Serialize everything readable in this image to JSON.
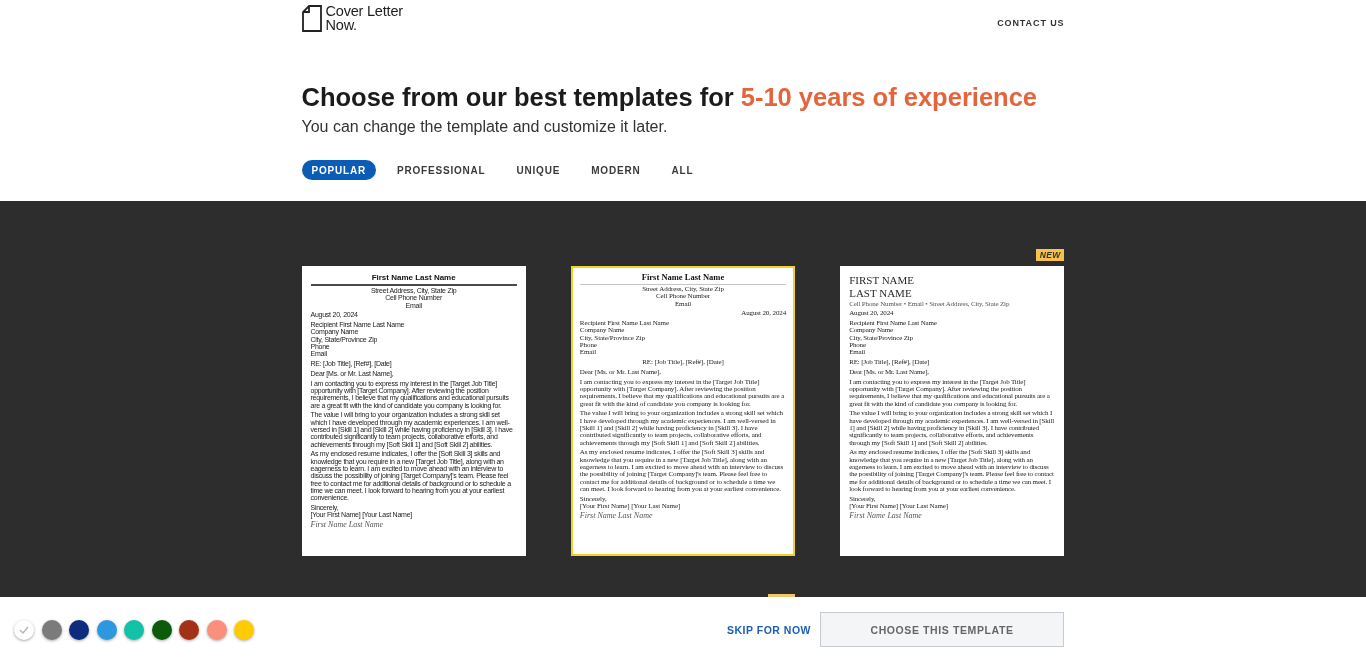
{
  "header": {
    "logo_lines": [
      "Cover Letter",
      "Now."
    ],
    "contact_link": "CONTACT US"
  },
  "heading": {
    "text": "Choose from our best templates for",
    "highlight": "5-10 years of experience",
    "subtitle": "You can change the template and customize it later."
  },
  "tabs": [
    {
      "label": "POPULAR",
      "selected": true
    },
    {
      "label": "PROFESSIONAL",
      "selected": false
    },
    {
      "label": "UNIQUE",
      "selected": false
    },
    {
      "label": "MODERN",
      "selected": false
    },
    {
      "label": "ALL",
      "selected": false
    }
  ],
  "templates": [
    {
      "kind": "classic",
      "selected": false,
      "name_lines": [
        "First Name Last Name"
      ],
      "contact_lines": [
        "Street Address, City, State Zip",
        "Cell Phone Number",
        "Email"
      ],
      "date": "August 20, 2024",
      "recipient_lines": [
        "Recipient First Name Last Name",
        "Company Name",
        "City, State/Province Zip",
        "Phone",
        "Email"
      ],
      "subject": "RE: [Job Title], [Ref#], [Date]",
      "salutation": "Dear [Ms. or Mr. Last Name],",
      "paragraphs": [
        "I am contacting you to express my interest in the [Target Job Title] opportunity with [Target Company]. After reviewing the position requirements, I believe that my qualifications and educational pursuits are a great fit with the kind of candidate you company is looking for.",
        "The value I will bring to your organization includes a strong skill set which I have developed through my academic experiences. I am well-versed in [Skill 1] and [Skill 2] while having proficiency in [Skill 3]. I have contributed significantly to team projects, collaborative efforts, and achievements through my [Soft Skill 1] and [Soft Skill 2] abilities.",
        "As my enclosed resume indicates, I offer the [Soft Skill 3] skills and knowledge that you require in a new [Target Job Title], along with an eagerness to learn. I am excited to move ahead with an interview to discuss the possibility of joining [Target Company]'s team. Please feel free to contact me for additional details of background or to schedule a time we can meet. I look forward to hearing from you at your earliest convenience."
      ],
      "closing": "Sincerely,",
      "sender": "[Your First Name] [Your Last Name]",
      "signature": "First Name Last Name"
    },
    {
      "kind": "centered",
      "selected": true,
      "name_lines": [
        "First Name Last Name"
      ],
      "contact_lines": [
        "Street Address, City, State Zip",
        "Cell Phone Number",
        "Email"
      ],
      "date": "August 20, 2024",
      "recipient_lines": [
        "Recipient First Name Last Name",
        "Company Name",
        "City, State/Province Zip",
        "Phone",
        "Email"
      ],
      "subject": "RE: [Job Title], [Ref#], [Date]",
      "salutation": "Dear [Ms. or Mr. Last Name],",
      "paragraphs": [
        "I am contacting you to express my interest in the [Target Job Title] opportunity with [Target Company]. After reviewing the position requirements, I believe that my qualifications and educational pursuits are a great fit with the kind of candidate you company is looking for.",
        "The value I will bring to your organization includes a strong skill set which I have developed through my academic experiences. I am well-versed in [Skill 1] and [Skill 2] while having proficiency in [Skill 3]. I have contributed significantly to team projects, collaborative efforts, and achievements through my [Soft Skill 1] and [Soft Skill 2] abilities.",
        "As my enclosed resume indicates, I offer the [Soft Skill 3] skills and knowledge that you require in a new [Target Job Title], along with an eagerness to learn. I am excited to move ahead with an interview to discuss the possibility of joining [Target Company]'s team. Please feel free to contact me for additional details of background or to schedule a time we can meet. I look forward to hearing from you at your earliest convenience."
      ],
      "closing": "Sincerely,",
      "sender": "[Your First Name] [Your Last Name]",
      "signature": "First Name Last Name"
    },
    {
      "kind": "modern",
      "selected": false,
      "badge": "NEW",
      "name_lines": [
        "FIRST NAME",
        "LAST NAME"
      ],
      "contact_lines": [
        "Cell Phone Number • Email • Street Address, City, State Zip"
      ],
      "date": "August 20, 2024",
      "recipient_lines": [
        "Recipient First Name Last Name",
        "Company Name",
        "City, State/Province Zip",
        "Phone",
        "Email"
      ],
      "subject": "RE: [Job Title], [Ref#], [Date]",
      "salutation": "Dear [Ms. or Mr. Last Name],",
      "paragraphs": [
        "I am contacting you to express my interest in the [Target Job Title] opportunity with [Target Company]. After reviewing the position requirements, I believe that my qualifications and educational pursuits are a great fit with the kind of candidate you company is looking for.",
        "The value I will bring to your organization includes a strong skill set which I have developed through my academic experiences. I am well-versed in [Skill 1] and [Skill 2] while having proficiency in [Skill 3]. I have contributed significantly to team projects, collaborative efforts, and achievements through my [Soft Skill 1] and [Soft Skill 2] abilities.",
        "As my enclosed resume indicates, I offer the [Soft Skill 3] skills and knowledge that you require in a new [Target Job Title], along with an eagerness to learn. I am excited to move ahead with an interview to discuss the possibility of joining [Target Company]'s team. Please feel free to contact me for additional details of background or to schedule a time we can meet. I look forward to hearing from you at your earliest convenience."
      ],
      "closing": "Sincerely,",
      "sender": "[Your First Name] [Your Last Name]",
      "signature": "First Name Last Name"
    }
  ],
  "footer": {
    "color_options": [
      {
        "color": "#ffffff",
        "selected": true
      },
      {
        "color": "#7b7b7b",
        "selected": false
      },
      {
        "color": "#0e2b7c",
        "selected": false
      },
      {
        "color": "#2d98e0",
        "selected": false
      },
      {
        "color": "#12c2a6",
        "selected": false
      },
      {
        "color": "#0b5b0b",
        "selected": false
      },
      {
        "color": "#a23118",
        "selected": false
      },
      {
        "color": "#fa8f7b",
        "selected": false
      },
      {
        "color": "#fecb00",
        "selected": false
      }
    ],
    "skip_link": "SKIP FOR NOW",
    "choose_button": "CHOOSE THIS TEMPLATE"
  }
}
